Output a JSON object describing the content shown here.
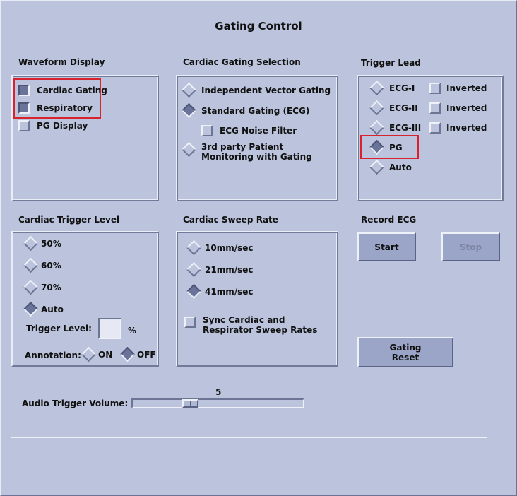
{
  "title": "Gating  Control",
  "waveform": {
    "label": "Waveform Display",
    "items": [
      {
        "label": "Cardiac Gating",
        "checked": true
      },
      {
        "label": "Respiratory",
        "checked": true
      },
      {
        "label": "PG Display",
        "checked": false
      }
    ]
  },
  "cardiac_selection": {
    "label": "Cardiac Gating Selection",
    "options": [
      {
        "label": "Independent Vector Gating",
        "selected": false
      },
      {
        "label": "Standard Gating (ECG)",
        "selected": true
      },
      {
        "label": "3rd party Patient Monitoring with Gating",
        "selected": false
      }
    ],
    "noise_filter": {
      "label": "ECG Noise Filter",
      "checked": false
    }
  },
  "trigger_lead": {
    "label": "Trigger Lead",
    "options": [
      {
        "label": "ECG-I",
        "selected": false,
        "inverted_label": "Inverted",
        "inverted": false
      },
      {
        "label": "ECG-II",
        "selected": false,
        "inverted_label": "Inverted",
        "inverted": false
      },
      {
        "label": "ECG-III",
        "selected": false,
        "inverted_label": "Inverted",
        "inverted": false
      },
      {
        "label": "PG",
        "selected": true
      },
      {
        "label": "Auto",
        "selected": false
      }
    ]
  },
  "trigger_level": {
    "label": "Cardiac Trigger Level",
    "options": [
      {
        "label": "50%",
        "selected": false
      },
      {
        "label": "60%",
        "selected": false
      },
      {
        "label": "70%",
        "selected": false
      },
      {
        "label": "Auto",
        "selected": true
      }
    ],
    "level_label": "Trigger Level:",
    "level_value": "",
    "percent": "%",
    "annotation_label": "Annotation:",
    "annotation_on": "ON",
    "annotation_off": "OFF",
    "annotation_selected": "OFF"
  },
  "sweep_rate": {
    "label": "Cardiac Sweep Rate",
    "options": [
      {
        "label": "10mm/sec",
        "selected": false
      },
      {
        "label": "21mm/sec",
        "selected": false
      },
      {
        "label": "41mm/sec",
        "selected": true
      }
    ],
    "sync": {
      "label": "Sync Cardiac and Respirator Sweep Rates",
      "checked": false
    }
  },
  "record_ecg": {
    "label": "Record ECG",
    "start": "Start",
    "stop": "Stop",
    "stop_enabled": false
  },
  "gating_reset": "Gating Reset",
  "audio": {
    "label": "Audio Trigger Volume:",
    "value": "5",
    "min": 0,
    "max": 20,
    "current": 5
  }
}
